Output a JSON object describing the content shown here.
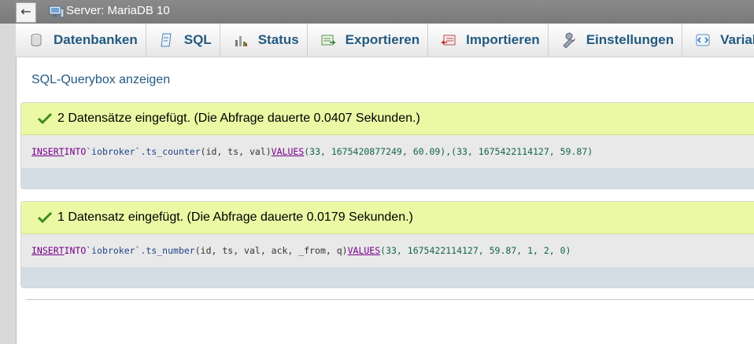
{
  "header": {
    "back_label": "←",
    "server_title": "Server: MariaDB 10"
  },
  "nav": {
    "tabs": [
      {
        "label": "Datenbanken",
        "icon": "database-icon"
      },
      {
        "label": "SQL",
        "icon": "sql-icon"
      },
      {
        "label": "Status",
        "icon": "status-icon"
      },
      {
        "label": "Exportieren",
        "icon": "export-icon"
      },
      {
        "label": "Importieren",
        "icon": "import-icon"
      },
      {
        "label": "Einstellungen",
        "icon": "wrench-icon"
      },
      {
        "label": "Variablen",
        "icon": "variables-icon"
      }
    ]
  },
  "main": {
    "querybox_link": "SQL-Querybox anzeigen",
    "results": [
      {
        "message": "2 Datensätze eingefügt. (Die Abfrage dauerte 0.0407 Sekunden.)",
        "sql": {
          "insert": "INSERT",
          "into": "INTO",
          "table": "`iobroker`.ts_counter",
          "columns": "(id, ts, val)",
          "values_kw": "VALUES",
          "values": "(33, 1675420877249, 60.09),(33, 1675422114127, 59.87)"
        }
      },
      {
        "message": "1 Datensatz eingefügt. (Die Abfrage dauerte 0.0179 Sekunden.)",
        "sql": {
          "insert": "INSERT",
          "into": "INTO",
          "table": "`iobroker`.ts_number",
          "columns": "(id, ts, val, ack, _from, q)",
          "values_kw": "VALUES",
          "values": "(33, 1675422114127, 59.87, 1, 2, 0)"
        }
      }
    ]
  },
  "colors": {
    "link": "#235a81",
    "success_bg": "#ebf8a4",
    "topbar": "#808080"
  }
}
